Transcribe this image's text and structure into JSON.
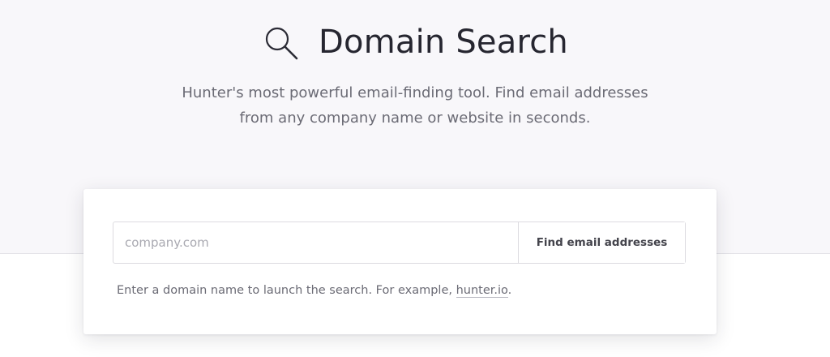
{
  "header": {
    "icon": "search-icon",
    "title": "Domain Search",
    "subtitle_line1": "Hunter's most powerful email-finding tool. Find email addresses",
    "subtitle_line2": "from any company name or website in seconds."
  },
  "search": {
    "placeholder": "company.com",
    "value": "",
    "button_label": "Find email addresses"
  },
  "hint": {
    "text": "Enter a domain name to launch the search. For example, ",
    "example_link": "hunter.io",
    "suffix": "."
  },
  "colors": {
    "hero_background": "#f8f7fa",
    "title": "#262630",
    "muted_text": "#6b6b75"
  }
}
